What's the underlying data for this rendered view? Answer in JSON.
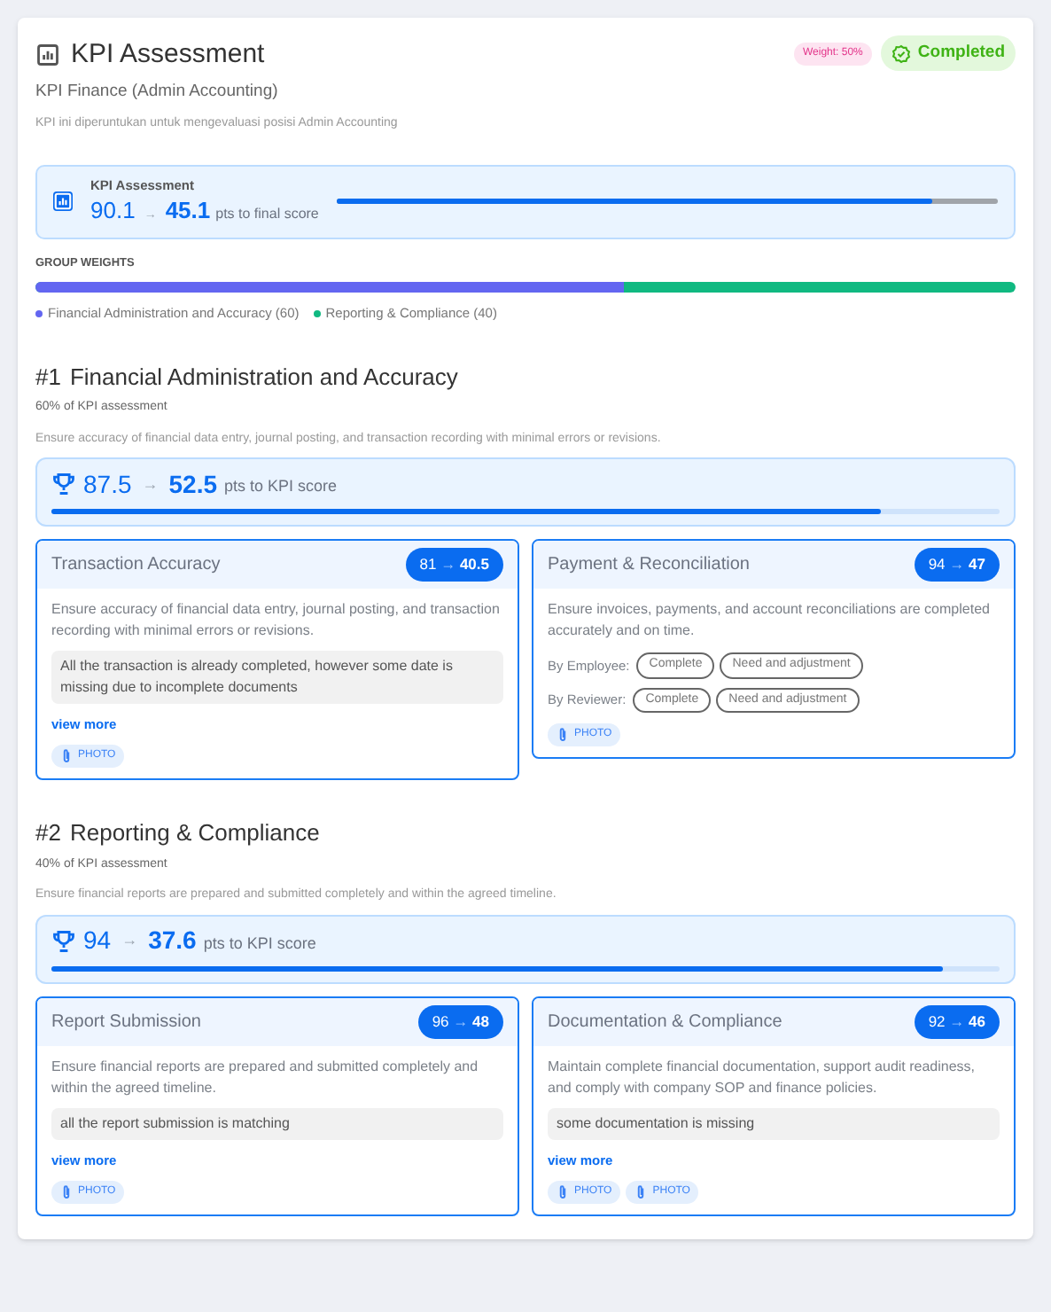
{
  "header": {
    "title": "KPI Assessment",
    "subtitle": "KPI Finance (Admin Accounting)",
    "description": "KPI ini diperuntukan untuk mengevaluasi posisi Admin Accounting",
    "weight_badge": "Weight: 50%",
    "status": "Completed"
  },
  "summary": {
    "label": "KPI Assessment",
    "score": "90.1",
    "arrow": "→",
    "points": "45.1",
    "suffix": "pts to final score",
    "level": 0.9
  },
  "group_weights": {
    "title": "GROUP WEIGHTS",
    "level": 0.6,
    "groups": [
      {
        "label": "Financial Administration and Accuracy (60)",
        "color": "#6366f1"
      },
      {
        "label": "Reporting & Compliance (40)",
        "color": "#10b981"
      }
    ]
  },
  "sections": [
    {
      "number": "#1",
      "title": "Financial Administration and Accuracy",
      "share": "60% of KPI assessment",
      "description": "Ensure accuracy of financial data entry, journal posting, and transaction recording with minimal errors or revisions.",
      "score": "87.5",
      "arrow": "→",
      "points": "52.5",
      "suffix": "pts to KPI score",
      "level": 0.875,
      "items": [
        {
          "kind": "note",
          "title": "Transaction Accuracy",
          "score": "81",
          "arrow": "→",
          "points": "40.5",
          "description": "Ensure accuracy of financial data entry, journal posting, and transaction recording with minimal errors or revisions.",
          "note": "All the transaction is already completed, however some date is missing due to incomplete documents",
          "link": "view more",
          "attachments": [
            "PHOTO"
          ]
        },
        {
          "kind": "choices",
          "title": "Payment & Reconciliation",
          "score": "94",
          "arrow": "→",
          "points": "47",
          "description": "Ensure invoices, payments, and account reconciliations are completed accurately and on time.",
          "rows": [
            {
              "label": "By Employee:",
              "options": [
                "Complete",
                "Need and adjustment"
              ]
            },
            {
              "label": "By Reviewer:",
              "options": [
                "Complete",
                "Need and adjustment"
              ]
            }
          ],
          "attachments": [
            "PHOTO"
          ]
        }
      ]
    },
    {
      "number": "#2",
      "title": "Reporting & Compliance",
      "share": "40% of KPI assessment",
      "description": "Ensure financial reports are prepared and submitted completely and within the agreed timeline.",
      "score": "94",
      "arrow": "→",
      "points": "37.6",
      "suffix": "pts to KPI score",
      "level": 0.94,
      "items": [
        {
          "kind": "note",
          "title": "Report Submission",
          "score": "96",
          "arrow": "→",
          "points": "48",
          "description": "Ensure financial reports are prepared and submitted completely and within the agreed timeline.",
          "note": "all the report submission is matching",
          "link": "view more",
          "attachments": [
            "PHOTO"
          ]
        },
        {
          "kind": "note",
          "title": "Documentation & Compliance",
          "score": "92",
          "arrow": "→",
          "points": "46",
          "description": "Maintain complete financial documentation, support audit readiness, and comply with company SOP and finance policies.",
          "note": "some documentation is missing",
          "link": "view more",
          "attachments": [
            "PHOTO",
            "PHOTO"
          ]
        }
      ]
    }
  ]
}
